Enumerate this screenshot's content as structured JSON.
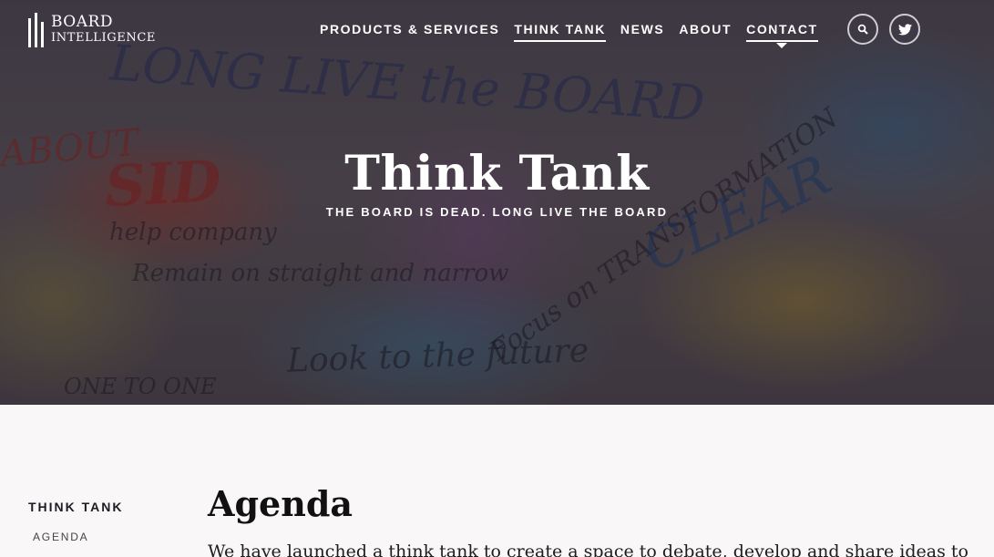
{
  "colors": {
    "accent": "#ffffff",
    "text": "#1e1c22",
    "background": "#f9f7f8"
  },
  "header": {
    "logo": {
      "line1": "BOARD",
      "line2": "INTELLIGENCE"
    },
    "nav": [
      {
        "label": "PRODUCTS & SERVICES"
      },
      {
        "label": "THINK TANK"
      },
      {
        "label": "NEWS"
      },
      {
        "label": "ABOUT"
      },
      {
        "label": "CONTACT"
      }
    ],
    "icons": {
      "search": "search-icon",
      "twitter": "twitter-icon"
    }
  },
  "hero": {
    "title": "Think Tank",
    "subtitle": "THE BOARD IS DEAD. LONG LIVE THE BOARD",
    "background_text": {
      "t1": "LONG LIVE the BOARD",
      "t2": "SID",
      "t3": "help company",
      "t4": "Remain on straight and narrow",
      "t5": "Look to the future",
      "t6": "ONE TO ONE",
      "t7": "Focus on TRANSFORMATION",
      "t8": "CLEAR",
      "t9": "ABOUT"
    }
  },
  "sidebar": {
    "heading": "THINK TANK",
    "items": [
      {
        "label": "AGENDA"
      }
    ]
  },
  "main": {
    "heading": "Agenda",
    "intro": "We have launched a think tank to create a space to debate, develop and share ideas to"
  }
}
